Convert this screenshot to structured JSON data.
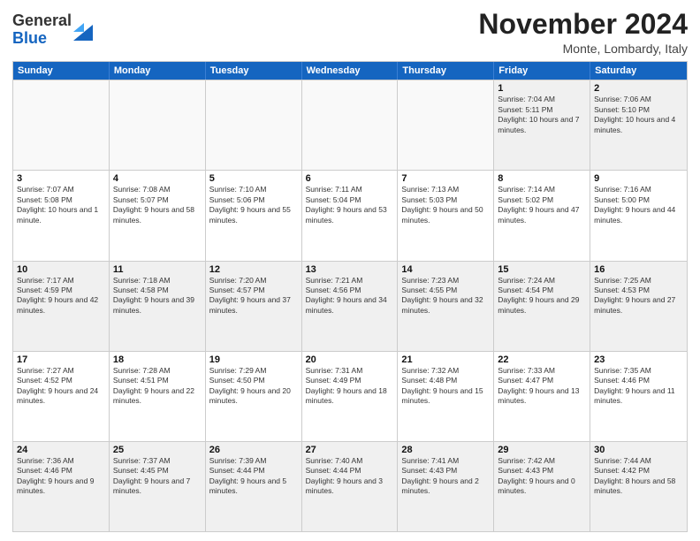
{
  "header": {
    "logo_general": "General",
    "logo_blue": "Blue",
    "month_title": "November 2024",
    "location": "Monte, Lombardy, Italy"
  },
  "calendar": {
    "days_of_week": [
      "Sunday",
      "Monday",
      "Tuesday",
      "Wednesday",
      "Thursday",
      "Friday",
      "Saturday"
    ],
    "rows": [
      [
        {
          "day": "",
          "empty": true
        },
        {
          "day": "",
          "empty": true
        },
        {
          "day": "",
          "empty": true
        },
        {
          "day": "",
          "empty": true
        },
        {
          "day": "",
          "empty": true
        },
        {
          "day": "1",
          "info": "Sunrise: 7:04 AM\nSunset: 5:11 PM\nDaylight: 10 hours and 7 minutes."
        },
        {
          "day": "2",
          "info": "Sunrise: 7:06 AM\nSunset: 5:10 PM\nDaylight: 10 hours and 4 minutes."
        }
      ],
      [
        {
          "day": "3",
          "info": "Sunrise: 7:07 AM\nSunset: 5:08 PM\nDaylight: 10 hours and 1 minute."
        },
        {
          "day": "4",
          "info": "Sunrise: 7:08 AM\nSunset: 5:07 PM\nDaylight: 9 hours and 58 minutes."
        },
        {
          "day": "5",
          "info": "Sunrise: 7:10 AM\nSunset: 5:06 PM\nDaylight: 9 hours and 55 minutes."
        },
        {
          "day": "6",
          "info": "Sunrise: 7:11 AM\nSunset: 5:04 PM\nDaylight: 9 hours and 53 minutes."
        },
        {
          "day": "7",
          "info": "Sunrise: 7:13 AM\nSunset: 5:03 PM\nDaylight: 9 hours and 50 minutes."
        },
        {
          "day": "8",
          "info": "Sunrise: 7:14 AM\nSunset: 5:02 PM\nDaylight: 9 hours and 47 minutes."
        },
        {
          "day": "9",
          "info": "Sunrise: 7:16 AM\nSunset: 5:00 PM\nDaylight: 9 hours and 44 minutes."
        }
      ],
      [
        {
          "day": "10",
          "info": "Sunrise: 7:17 AM\nSunset: 4:59 PM\nDaylight: 9 hours and 42 minutes."
        },
        {
          "day": "11",
          "info": "Sunrise: 7:18 AM\nSunset: 4:58 PM\nDaylight: 9 hours and 39 minutes."
        },
        {
          "day": "12",
          "info": "Sunrise: 7:20 AM\nSunset: 4:57 PM\nDaylight: 9 hours and 37 minutes."
        },
        {
          "day": "13",
          "info": "Sunrise: 7:21 AM\nSunset: 4:56 PM\nDaylight: 9 hours and 34 minutes."
        },
        {
          "day": "14",
          "info": "Sunrise: 7:23 AM\nSunset: 4:55 PM\nDaylight: 9 hours and 32 minutes."
        },
        {
          "day": "15",
          "info": "Sunrise: 7:24 AM\nSunset: 4:54 PM\nDaylight: 9 hours and 29 minutes."
        },
        {
          "day": "16",
          "info": "Sunrise: 7:25 AM\nSunset: 4:53 PM\nDaylight: 9 hours and 27 minutes."
        }
      ],
      [
        {
          "day": "17",
          "info": "Sunrise: 7:27 AM\nSunset: 4:52 PM\nDaylight: 9 hours and 24 minutes."
        },
        {
          "day": "18",
          "info": "Sunrise: 7:28 AM\nSunset: 4:51 PM\nDaylight: 9 hours and 22 minutes."
        },
        {
          "day": "19",
          "info": "Sunrise: 7:29 AM\nSunset: 4:50 PM\nDaylight: 9 hours and 20 minutes."
        },
        {
          "day": "20",
          "info": "Sunrise: 7:31 AM\nSunset: 4:49 PM\nDaylight: 9 hours and 18 minutes."
        },
        {
          "day": "21",
          "info": "Sunrise: 7:32 AM\nSunset: 4:48 PM\nDaylight: 9 hours and 15 minutes."
        },
        {
          "day": "22",
          "info": "Sunrise: 7:33 AM\nSunset: 4:47 PM\nDaylight: 9 hours and 13 minutes."
        },
        {
          "day": "23",
          "info": "Sunrise: 7:35 AM\nSunset: 4:46 PM\nDaylight: 9 hours and 11 minutes."
        }
      ],
      [
        {
          "day": "24",
          "info": "Sunrise: 7:36 AM\nSunset: 4:46 PM\nDaylight: 9 hours and 9 minutes."
        },
        {
          "day": "25",
          "info": "Sunrise: 7:37 AM\nSunset: 4:45 PM\nDaylight: 9 hours and 7 minutes."
        },
        {
          "day": "26",
          "info": "Sunrise: 7:39 AM\nSunset: 4:44 PM\nDaylight: 9 hours and 5 minutes."
        },
        {
          "day": "27",
          "info": "Sunrise: 7:40 AM\nSunset: 4:44 PM\nDaylight: 9 hours and 3 minutes."
        },
        {
          "day": "28",
          "info": "Sunrise: 7:41 AM\nSunset: 4:43 PM\nDaylight: 9 hours and 2 minutes."
        },
        {
          "day": "29",
          "info": "Sunrise: 7:42 AM\nSunset: 4:43 PM\nDaylight: 9 hours and 0 minutes."
        },
        {
          "day": "30",
          "info": "Sunrise: 7:44 AM\nSunset: 4:42 PM\nDaylight: 8 hours and 58 minutes."
        }
      ]
    ]
  }
}
